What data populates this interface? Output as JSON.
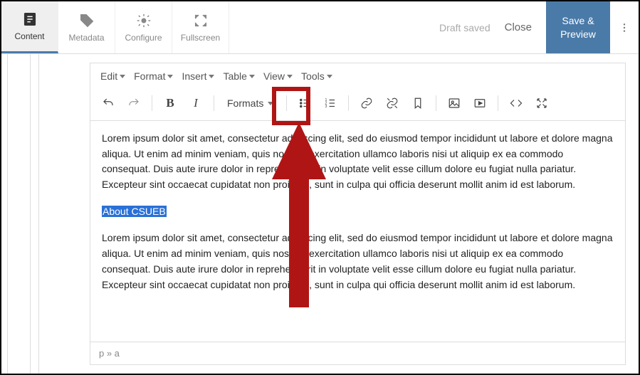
{
  "tabs": {
    "content": "Content",
    "metadata": "Metadata",
    "configure": "Configure",
    "fullscreen": "Fullscreen"
  },
  "topright": {
    "draft": "Draft saved",
    "close": "Close",
    "save": "Save & Preview"
  },
  "menus": {
    "edit": "Edit",
    "format": "Format",
    "insert": "Insert",
    "table": "Table",
    "view": "View",
    "tools": "Tools"
  },
  "formats_label": "Formats",
  "body": {
    "p1": "Lorem ipsum dolor sit amet, consectetur adipiscing elit, sed do eiusmod tempor incididunt ut labore et dolore magna aliqua. Ut enim ad minim veniam, quis nostrud exercitation ullamco laboris nisi ut aliquip ex ea commodo consequat. Duis aute irure dolor in reprehenderit in voluptate velit esse cillum dolore eu fugiat nulla pariatur. Excepteur sint occaecat cupidatat non proident, sunt in culpa qui officia deserunt mollit anim id est laborum.",
    "link": "About CSUEB",
    "p2": "Lorem ipsum dolor sit amet, consectetur adipiscing elit, sed do eiusmod tempor incididunt ut labore et dolore magna aliqua. Ut enim ad minim veniam, quis nostrud exercitation ullamco laboris nisi ut aliquip ex ea commodo consequat. Duis aute irure dolor in reprehenderit in voluptate velit esse cillum dolore eu fugiat nulla pariatur. Excepteur sint occaecat cupidatat non proident, sunt in culpa qui officia deserunt mollit anim id est laborum."
  },
  "statusbar": "p » a"
}
